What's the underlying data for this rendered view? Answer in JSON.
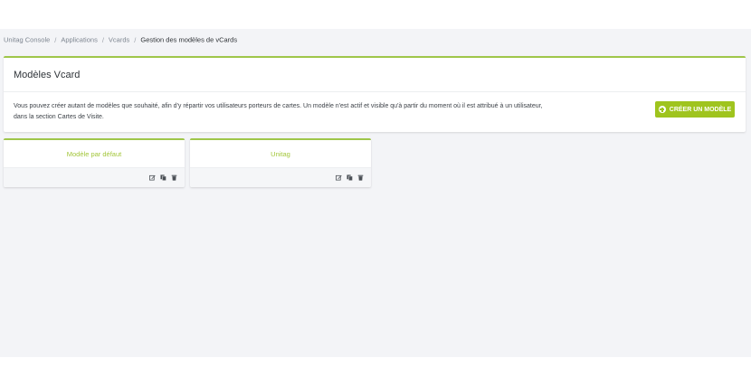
{
  "breadcrumb": {
    "items": [
      "Unitag Console",
      "Applications",
      "Vcards"
    ],
    "current": "Gestion des modèles de vCards",
    "separator": "/"
  },
  "panel": {
    "title": "Modèles Vcard",
    "description": "Vous pouvez créer autant de modèles que souhaité, afin d'y répartir vos utilisateurs porteurs de cartes. Un modèle n'est actif et visible qu'à partir du moment où il est attribué à un utilisateur, dans la section Cartes de Visite.",
    "create_button": "CRÉER UN MODÈLE"
  },
  "cards": [
    {
      "title": "Modèle par défaut"
    },
    {
      "title": "Unitag"
    }
  ],
  "colors": {
    "accent": "#9fc41e",
    "card_title": "#a3c63a",
    "background": "#f3f4f7"
  },
  "icons": [
    "edit-icon",
    "copy-icon",
    "trash-icon"
  ]
}
